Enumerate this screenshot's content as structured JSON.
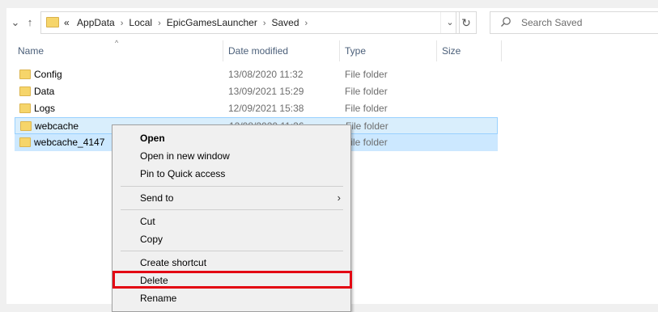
{
  "nav": {
    "collapse_icon": "chevron-down-icon",
    "up_icon": "up-arrow-icon",
    "overflow": "«",
    "breadcrumbs": [
      "AppData",
      "Local",
      "EpicGamesLauncher",
      "Saved"
    ],
    "search_placeholder": "Search Saved"
  },
  "columns": {
    "name": "Name",
    "date": "Date modified",
    "type": "Type",
    "size": "Size"
  },
  "files": [
    {
      "name": "Config",
      "date": "13/08/2020 11:32",
      "type": "File folder"
    },
    {
      "name": "Data",
      "date": "13/09/2021 15:29",
      "type": "File folder"
    },
    {
      "name": "Logs",
      "date": "12/09/2021 15:38",
      "type": "File folder"
    },
    {
      "name": "webcache",
      "date": "12/08/2020 11:36",
      "type": "File folder"
    },
    {
      "name": "webcache_4147",
      "date": "",
      "type": "File folder"
    }
  ],
  "menu": {
    "open": "Open",
    "open_new_window": "Open in new window",
    "pin_quick_access": "Pin to Quick access",
    "send_to": "Send to",
    "cut": "Cut",
    "copy": "Copy",
    "create_shortcut": "Create shortcut",
    "delete": "Delete",
    "rename": "Rename"
  },
  "colors": {
    "selection": "#cce8ff",
    "highlight_border": "#e30613",
    "folder": "#f6d56a"
  }
}
